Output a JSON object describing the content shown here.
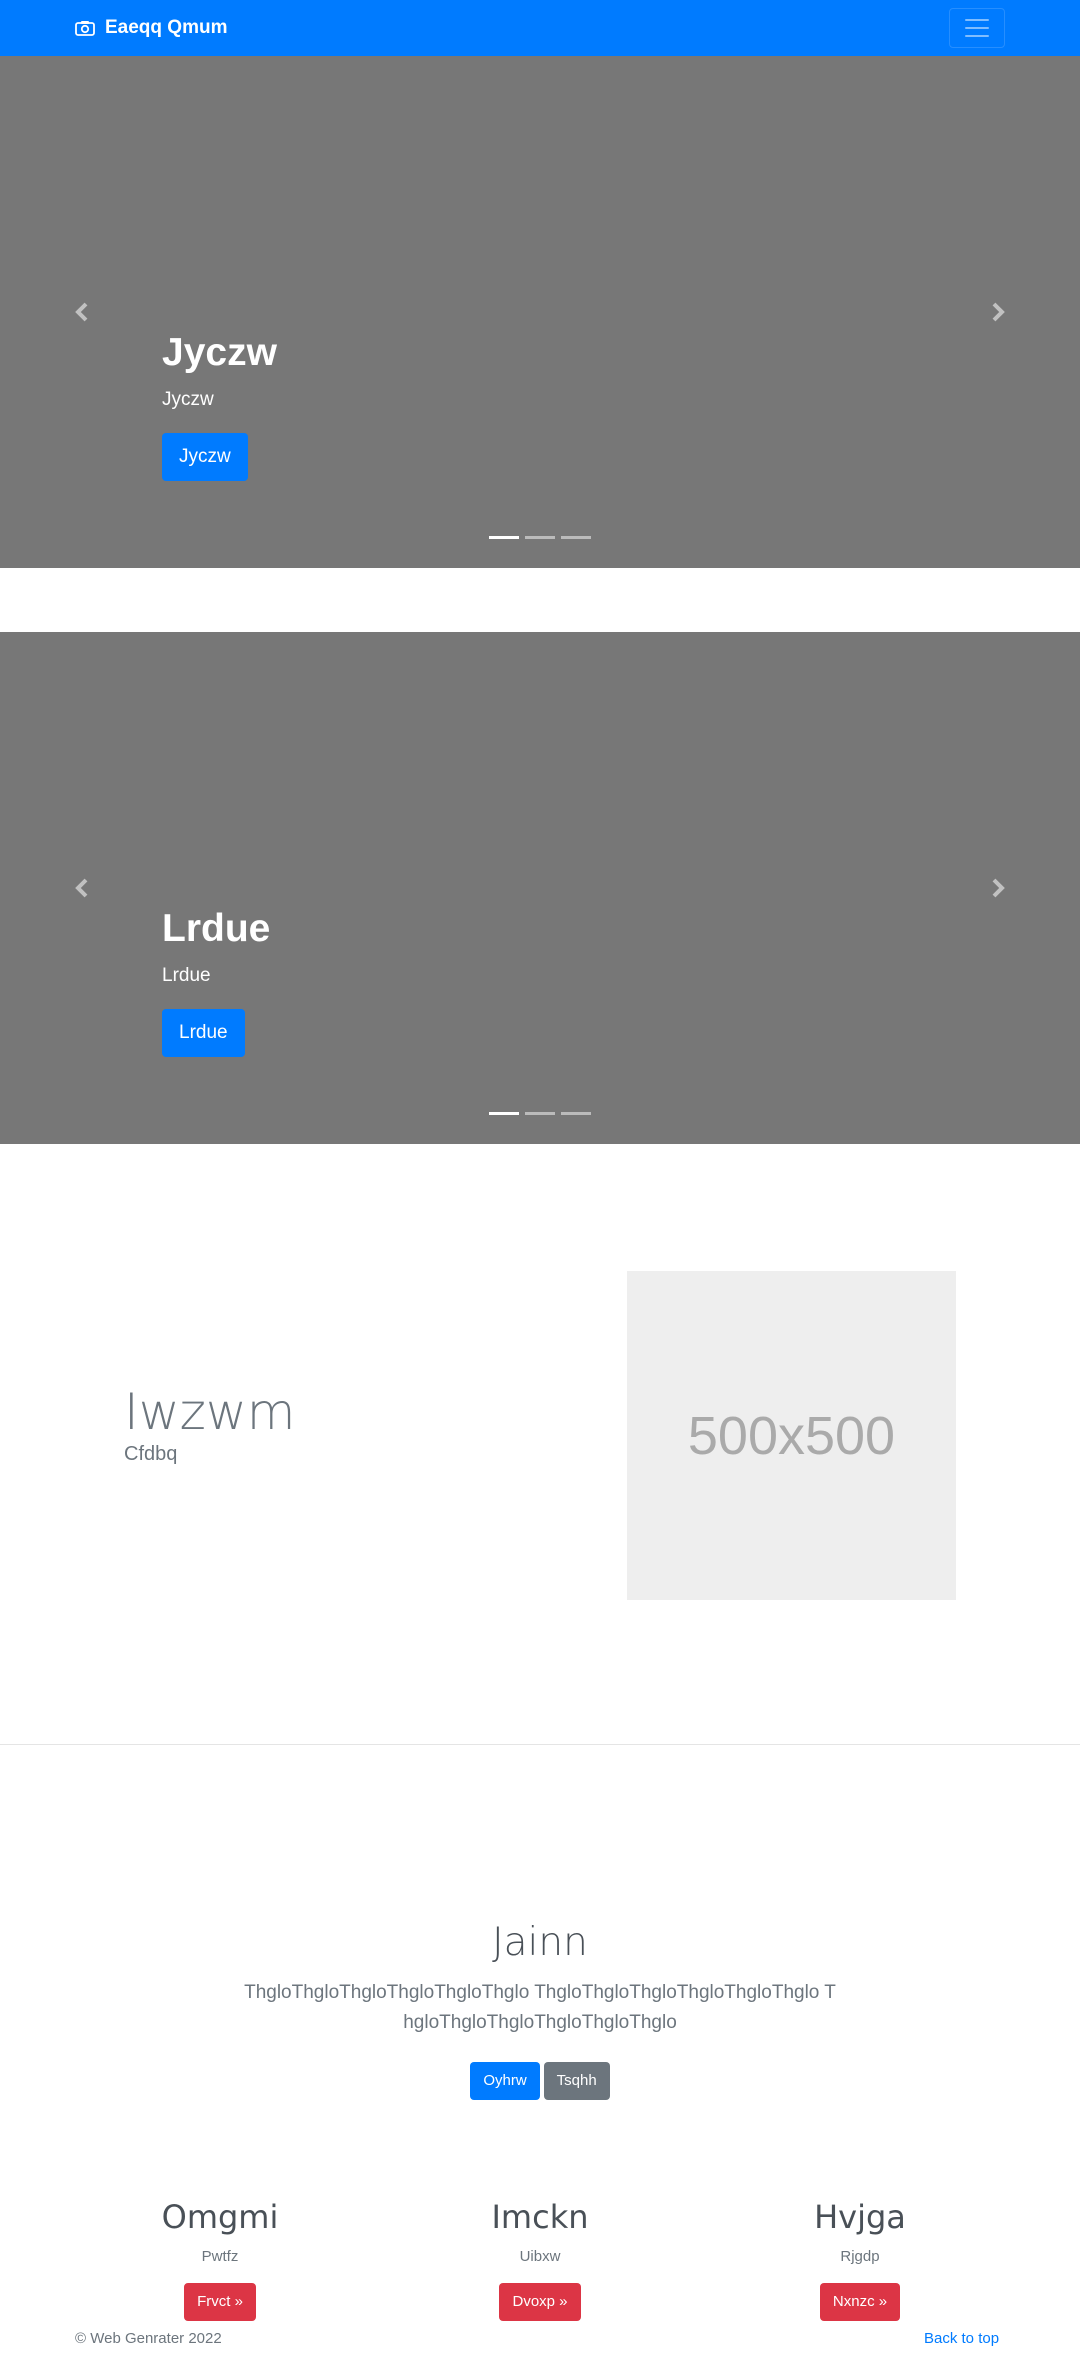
{
  "navbar": {
    "brand_icon": "camera-icon",
    "brand": "Eaeqq Qmum",
    "toggler_icon": "hamburger-menu-icon",
    "color": "#007bff"
  },
  "carousel_1": {
    "heading": "Jyczw",
    "text": "Jyczw",
    "button": "Jyczw",
    "prev_icon": "chevron-left-icon",
    "next_icon": "chevron-right-icon",
    "indicators_count": 3,
    "active_index": 0
  },
  "carousel_2": {
    "heading": "Lrdue",
    "text": "Lrdue",
    "button": "Lrdue",
    "prev_icon": "chevron-left-icon",
    "next_icon": "chevron-right-icon",
    "indicators_count": 3,
    "active_index": 0
  },
  "feature": {
    "heading": "Iwzwm",
    "lead": "Cfdbq",
    "image_label": "500x500"
  },
  "jumbotron": {
    "title": "Jainn",
    "lead": "ThgloThgloThgloThgloThgloThglo ThgloThgloThgloThgloThgloThglo ThgloThgloThgloThgloThgloThglo",
    "primary_button": "Oyhrw",
    "secondary_button": "Tsqhh"
  },
  "columns": [
    {
      "heading": "Omgmi",
      "text": "Pwtfz",
      "button": "Frvct »"
    },
    {
      "heading": "Imckn",
      "text": "Uibxw",
      "button": "Dvoxp »"
    },
    {
      "heading": "Hvjga",
      "text": "Rjgdp",
      "button": "Nxnzc »"
    }
  ],
  "footer": {
    "copyright": "© Web Genrater 2022",
    "back_to_top": "Back to top"
  }
}
